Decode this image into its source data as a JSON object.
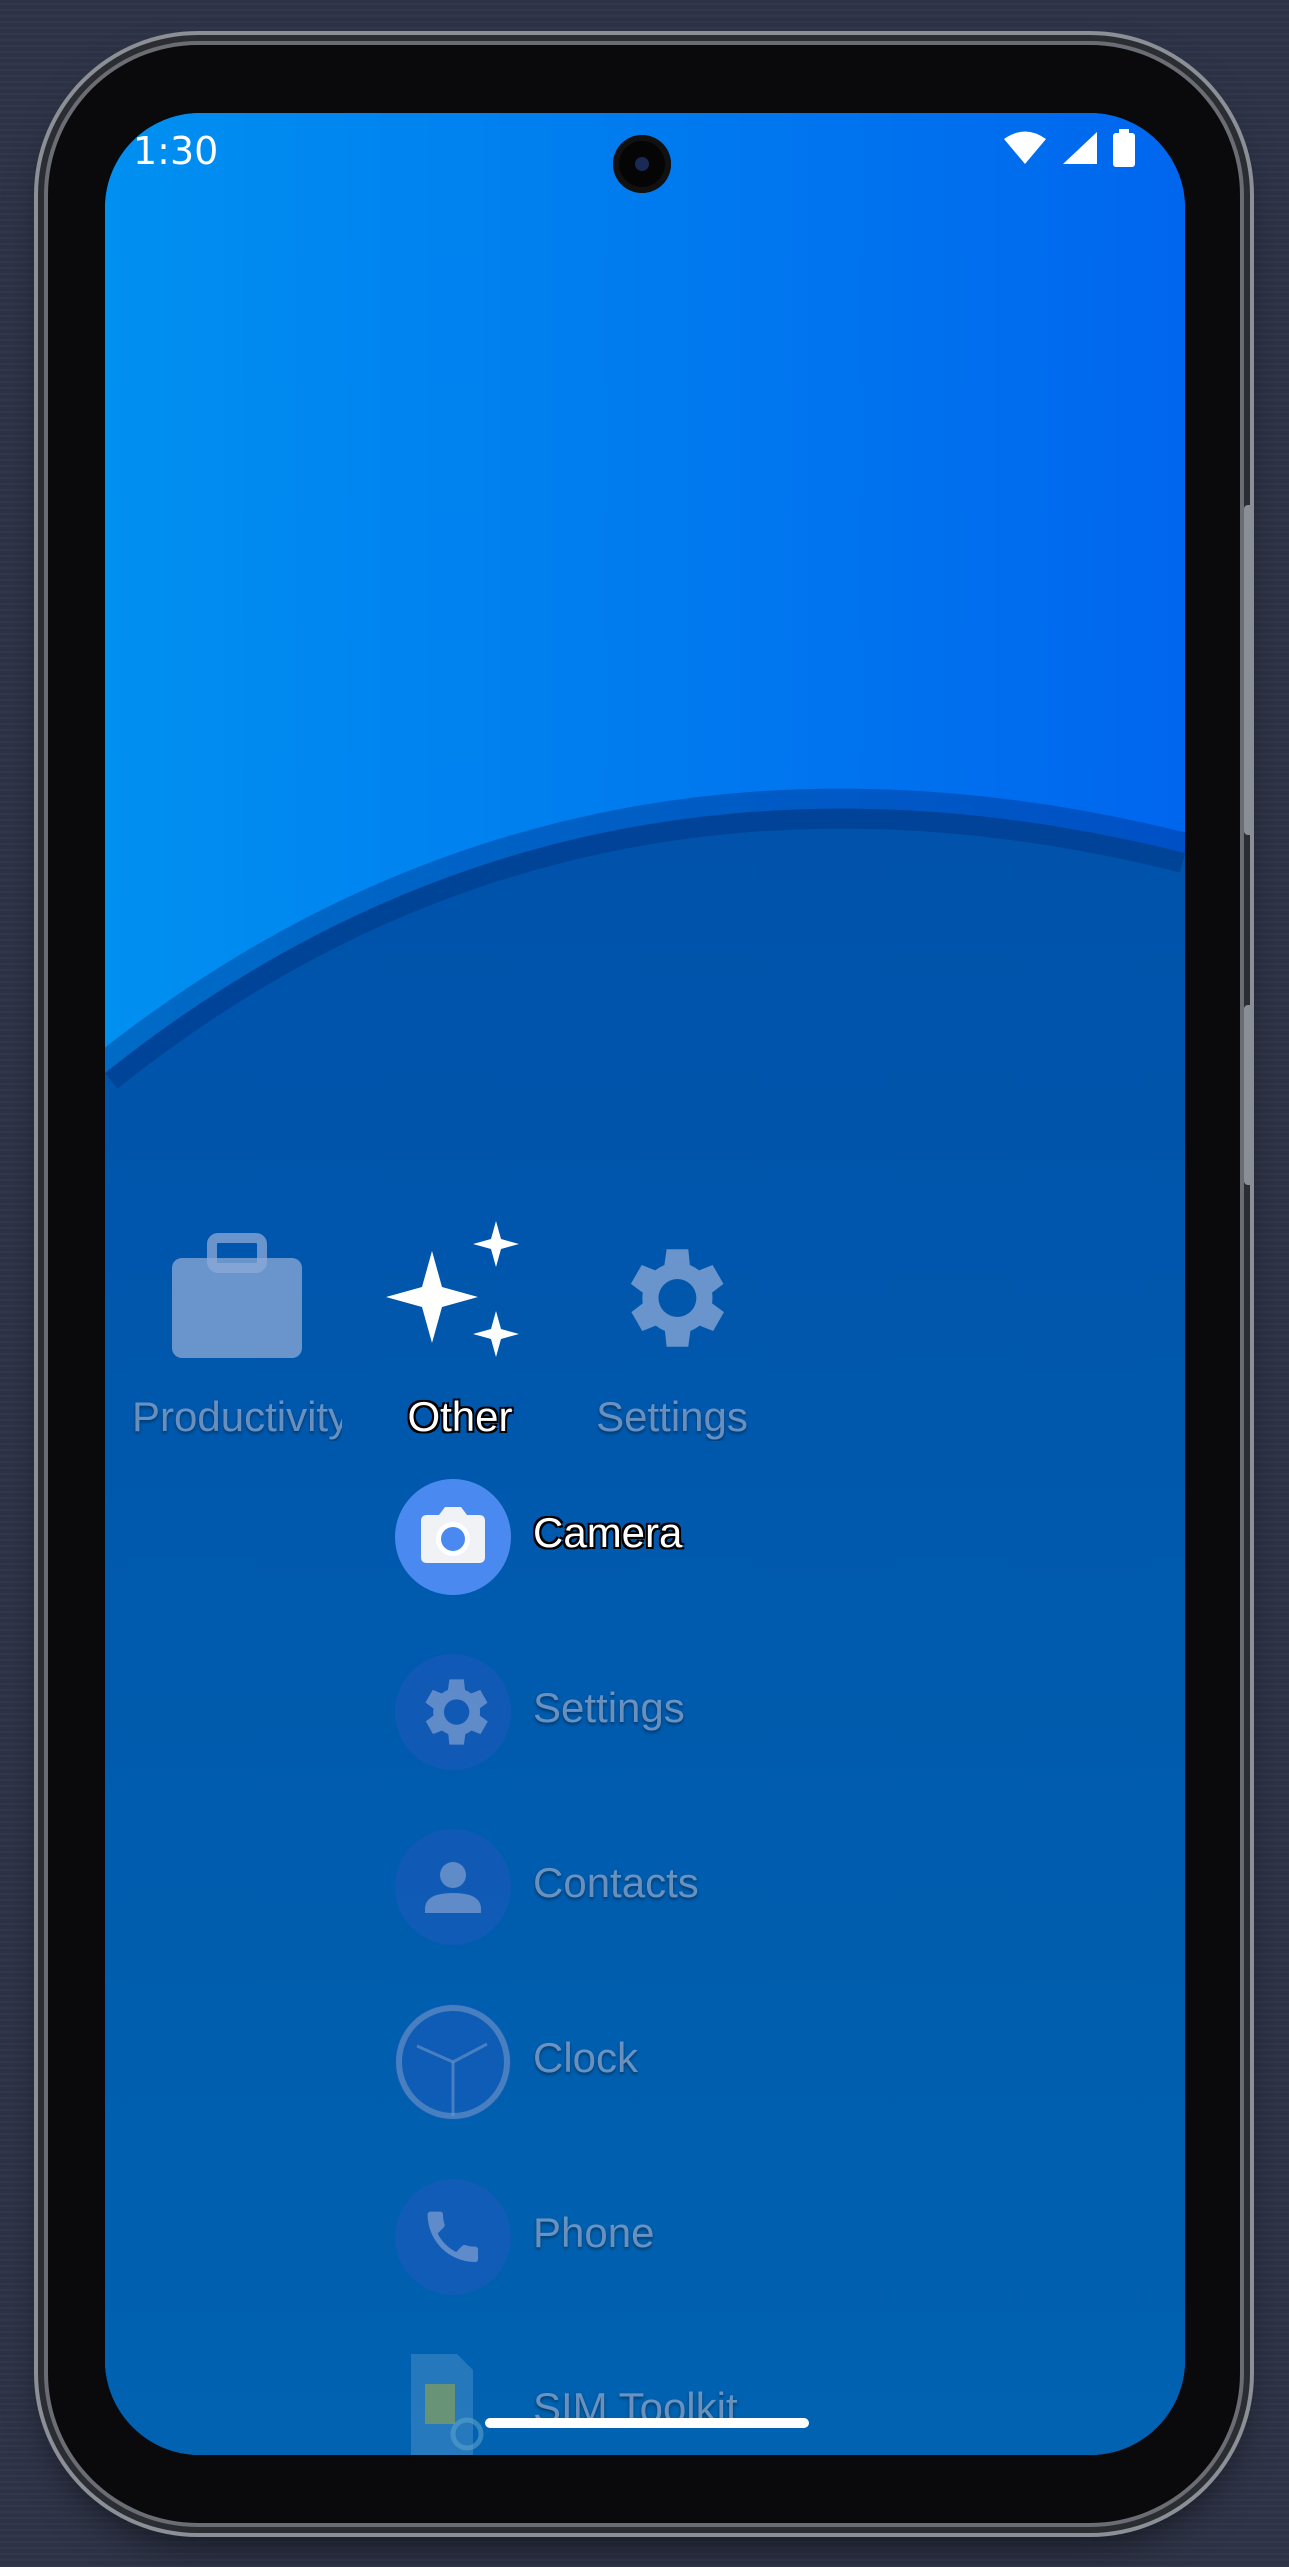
{
  "status_bar": {
    "time": "1:30"
  },
  "categories": [
    {
      "label": "Productivity",
      "icon": "briefcase-icon",
      "active": false
    },
    {
      "label": "Other",
      "icon": "sparkle-icon",
      "active": true
    },
    {
      "label": "Settings",
      "icon": "gear-icon",
      "active": false
    }
  ],
  "apps": [
    {
      "label": "Camera",
      "icon": "camera-icon",
      "active": true
    },
    {
      "label": "Settings",
      "icon": "gear-icon",
      "active": false
    },
    {
      "label": "Contacts",
      "icon": "person-icon",
      "active": false
    },
    {
      "label": "Clock",
      "icon": "clock-icon",
      "active": false
    },
    {
      "label": "Phone",
      "icon": "phone-icon",
      "active": false
    },
    {
      "label": "SIM Toolkit",
      "icon": "sim-card-icon",
      "active": false
    }
  ],
  "colors": {
    "wallpaper_top": "#0067f5",
    "wallpaper_bottom": "#0057b8",
    "camera_icon_bg": "#4a8af0"
  }
}
